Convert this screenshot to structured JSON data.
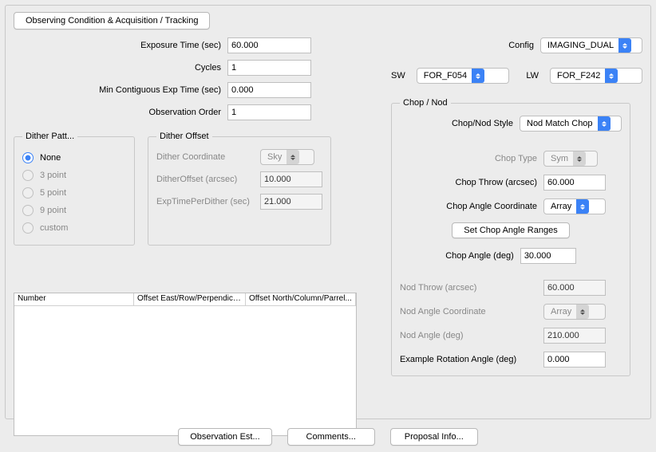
{
  "header": {
    "title": "Observing Condition & Acquisition / Tracking"
  },
  "exposure": {
    "exp_time_label": "Exposure Time (sec)",
    "exp_time_value": "60.000",
    "cycles_label": "Cycles",
    "cycles_value": "1",
    "min_contig_label": "Min Contiguous Exp Time (sec)",
    "min_contig_value": "0.000",
    "obs_order_label": "Observation Order",
    "obs_order_value": "1"
  },
  "config": {
    "config_label": "Config",
    "config_value": "IMAGING_DUAL",
    "sw_label": "SW",
    "sw_value": "FOR_F054",
    "lw_label": "LW",
    "lw_value": "FOR_F242"
  },
  "dither": {
    "pattern_legend": "Dither Patt...",
    "none": "None",
    "p3": "3 point",
    "p5": "5 point",
    "p9": "9 point",
    "custom": "custom"
  },
  "dither_offset": {
    "legend": "Dither Offset",
    "coord_label": "Dither Coordinate",
    "coord_value": "Sky",
    "offset_label": "DitherOffset (arcsec)",
    "offset_value": "10.000",
    "exp_per_label": "ExpTimePerDither (sec)",
    "exp_per_value": "21.000"
  },
  "table": {
    "col1": "Number",
    "col2": "Offset East/Row/Perpendicu...",
    "col3": "Offset North/Column/Parrel..."
  },
  "chopnod": {
    "legend": "Chop / Nod",
    "style_label": "Chop/Nod Style",
    "style_value": "Nod Match Chop",
    "type_label": "Chop Type",
    "type_value": "Sym",
    "throw_label": "Chop Throw (arcsec)",
    "throw_value": "60.000",
    "angle_coord_label": "Chop Angle Coordinate",
    "angle_coord_value": "Array",
    "set_ranges": "Set Chop Angle Ranges",
    "angle_label": "Chop Angle (deg)",
    "angle_value": "30.000",
    "nod_throw_label": "Nod Throw (arcsec)",
    "nod_throw_value": "60.000",
    "nod_angle_coord_label": "Nod Angle Coordinate",
    "nod_angle_coord_value": "Array",
    "nod_angle_label": "Nod Angle (deg)",
    "nod_angle_value": "210.000",
    "example_rot_label": "Example Rotation Angle (deg)",
    "example_rot_value": "0.000"
  },
  "footer": {
    "obs_est": "Observation Est...",
    "comments": "Comments...",
    "proposal": "Proposal Info..."
  }
}
